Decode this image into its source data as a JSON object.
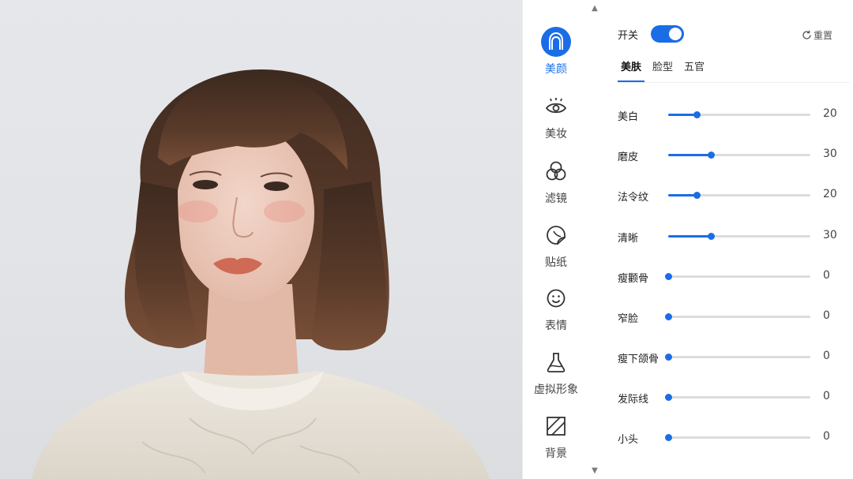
{
  "rail": {
    "items": [
      {
        "label": "美颜",
        "icon": "face-beauty-icon",
        "active": true
      },
      {
        "label": "美妆",
        "icon": "eye-makeup-icon",
        "active": false
      },
      {
        "label": "滤镜",
        "icon": "filter-circles-icon",
        "active": false
      },
      {
        "label": "贴纸",
        "icon": "sticker-icon",
        "active": false
      },
      {
        "label": "表情",
        "icon": "smiley-icon",
        "active": false
      },
      {
        "label": "虚拟形象",
        "icon": "avatar-flask-icon",
        "active": false
      },
      {
        "label": "背景",
        "icon": "background-icon",
        "active": false
      }
    ]
  },
  "panel": {
    "toggle_label": "开关",
    "toggle_on": true,
    "reset_label": "重置",
    "tabs": [
      {
        "label": "美肤",
        "active": true
      },
      {
        "label": "脸型",
        "active": false
      },
      {
        "label": "五官",
        "active": false
      }
    ],
    "sliders": [
      {
        "label": "美白",
        "value": "20",
        "fraction": 0.2
      },
      {
        "label": "磨皮",
        "value": "30",
        "fraction": 0.3
      },
      {
        "label": "法令纹",
        "value": "20",
        "fraction": 0.2
      },
      {
        "label": "清晰",
        "value": "30",
        "fraction": 0.3
      },
      {
        "label": "瘦颧骨",
        "value": "0",
        "fraction": 0
      },
      {
        "label": "窄脸",
        "value": "0",
        "fraction": 0
      },
      {
        "label": "瘦下颌骨",
        "value": "0",
        "fraction": 0
      },
      {
        "label": "发际线",
        "value": "0",
        "fraction": 0
      },
      {
        "label": "小头",
        "value": "0",
        "fraction": 0
      }
    ]
  },
  "colors": {
    "accent": "#1a6de6",
    "active_text": "#1a73e8",
    "track": "#dcdcdc"
  }
}
